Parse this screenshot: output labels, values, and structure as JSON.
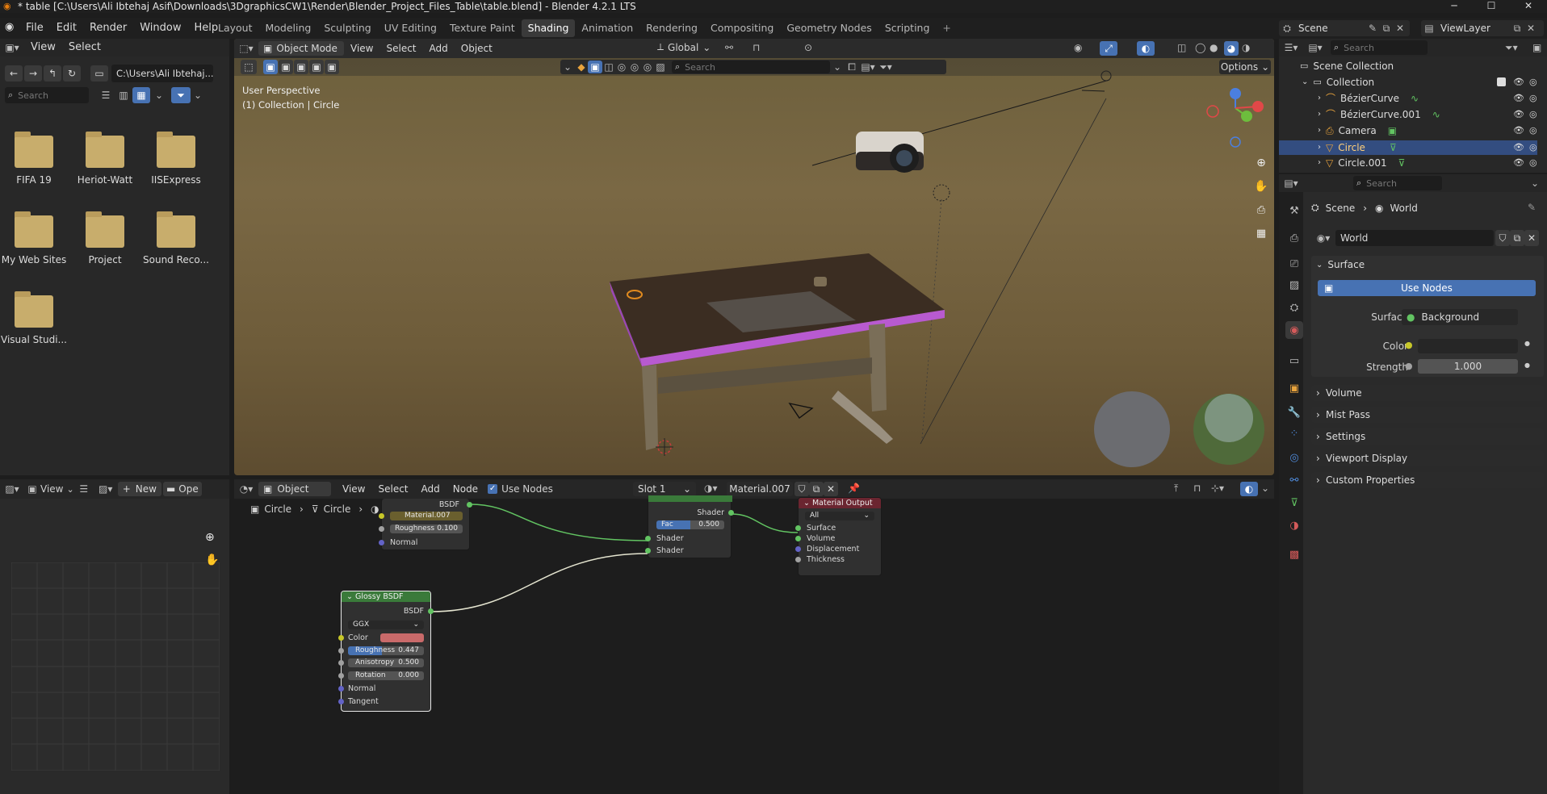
{
  "app": {
    "title": "* table [C:\\Users\\Ali Ibtehaj Asif\\Downloads\\3DgraphicsCW1\\Render\\Blender_Project_Files_Table\\table.blend] - Blender 4.2.1 LTS",
    "menus": [
      "File",
      "Edit",
      "Render",
      "Window",
      "Help"
    ],
    "workspaces": [
      "Layout",
      "Modeling",
      "Sculpting",
      "UV Editing",
      "Texture Paint",
      "Shading",
      "Animation",
      "Rendering",
      "Compositing",
      "Geometry Nodes",
      "Scripting"
    ],
    "active_workspace": "Shading",
    "scene": "Scene",
    "view_layer": "ViewLayer"
  },
  "file_browser": {
    "menu": [
      "View",
      "Select"
    ],
    "path": "C:\\Users\\Ali Ibtehaj...",
    "search_placeholder": "Search",
    "items": [
      "FIFA 19",
      "Heriot-Watt",
      "IISExpress",
      "My Web Sites",
      "Project",
      "Sound Reco...",
      "Visual Studi..."
    ]
  },
  "viewport": {
    "mode": "Object Mode",
    "menus": [
      "View",
      "Select",
      "Add",
      "Object"
    ],
    "transform": "Global",
    "search_placeholder": "Search",
    "options": "Options",
    "info_line1": "User Perspective",
    "info_line2": "(1) Collection | Circle"
  },
  "image_editor": {
    "view": "View",
    "new": "New",
    "open": "Ope"
  },
  "node_editor": {
    "object": "Object",
    "menus": [
      "View",
      "Select",
      "Add",
      "Node"
    ],
    "use_nodes": "Use Nodes",
    "slot": "Slot 1",
    "material": "Material.007",
    "breadcrumb": [
      "Circle",
      "Circle"
    ],
    "node_top": {
      "bsdf": "BSDF",
      "material_field": "Material.007",
      "roughness_label": "Roughness",
      "roughness": "0.100",
      "normal": "Normal"
    },
    "mix_shader": {
      "out": "Shader",
      "fac_label": "Fac",
      "fac": "0.500",
      "in1": "Shader",
      "in2": "Shader"
    },
    "material_output": {
      "title": "Material Output",
      "target": "All",
      "inputs": [
        "Surface",
        "Volume",
        "Displacement",
        "Thickness"
      ]
    },
    "glossy": {
      "title": "Glossy BSDF",
      "out": "BSDF",
      "distribution": "GGX",
      "color_label": "Color",
      "color": "#c96a6a",
      "roughness_label": "Roughness",
      "roughness": "0.447",
      "anisotropy_label": "Anisotropy",
      "anisotropy": "0.500",
      "rotation_label": "Rotation",
      "rotation": "0.000",
      "normal": "Normal",
      "tangent": "Tangent"
    }
  },
  "outliner": {
    "search_placeholder": "Search",
    "scene_collection": "Scene Collection",
    "collection": "Collection",
    "items": [
      "BézierCurve",
      "BézierCurve.001",
      "Camera",
      "Circle",
      "Circle.001"
    ],
    "selected": "Circle"
  },
  "properties": {
    "search_placeholder": "Search",
    "breadcrumb": [
      "Scene",
      "World"
    ],
    "world_name": "World",
    "surface_panel": "Surface",
    "use_nodes": "Use Nodes",
    "surface_label": "Surface",
    "surface_value": "Background",
    "color_label": "Color",
    "strength_label": "Strength",
    "strength_value": "1.000",
    "collapsed_panels": [
      "Volume",
      "Mist Pass",
      "Settings",
      "Viewport Display",
      "Custom Properties"
    ]
  },
  "colors": {
    "accent": "#4772b3",
    "selected_row": "#334d80",
    "node_green": "#3a7a3a",
    "output_red": "#6b2530",
    "link_green": "#62c462"
  }
}
